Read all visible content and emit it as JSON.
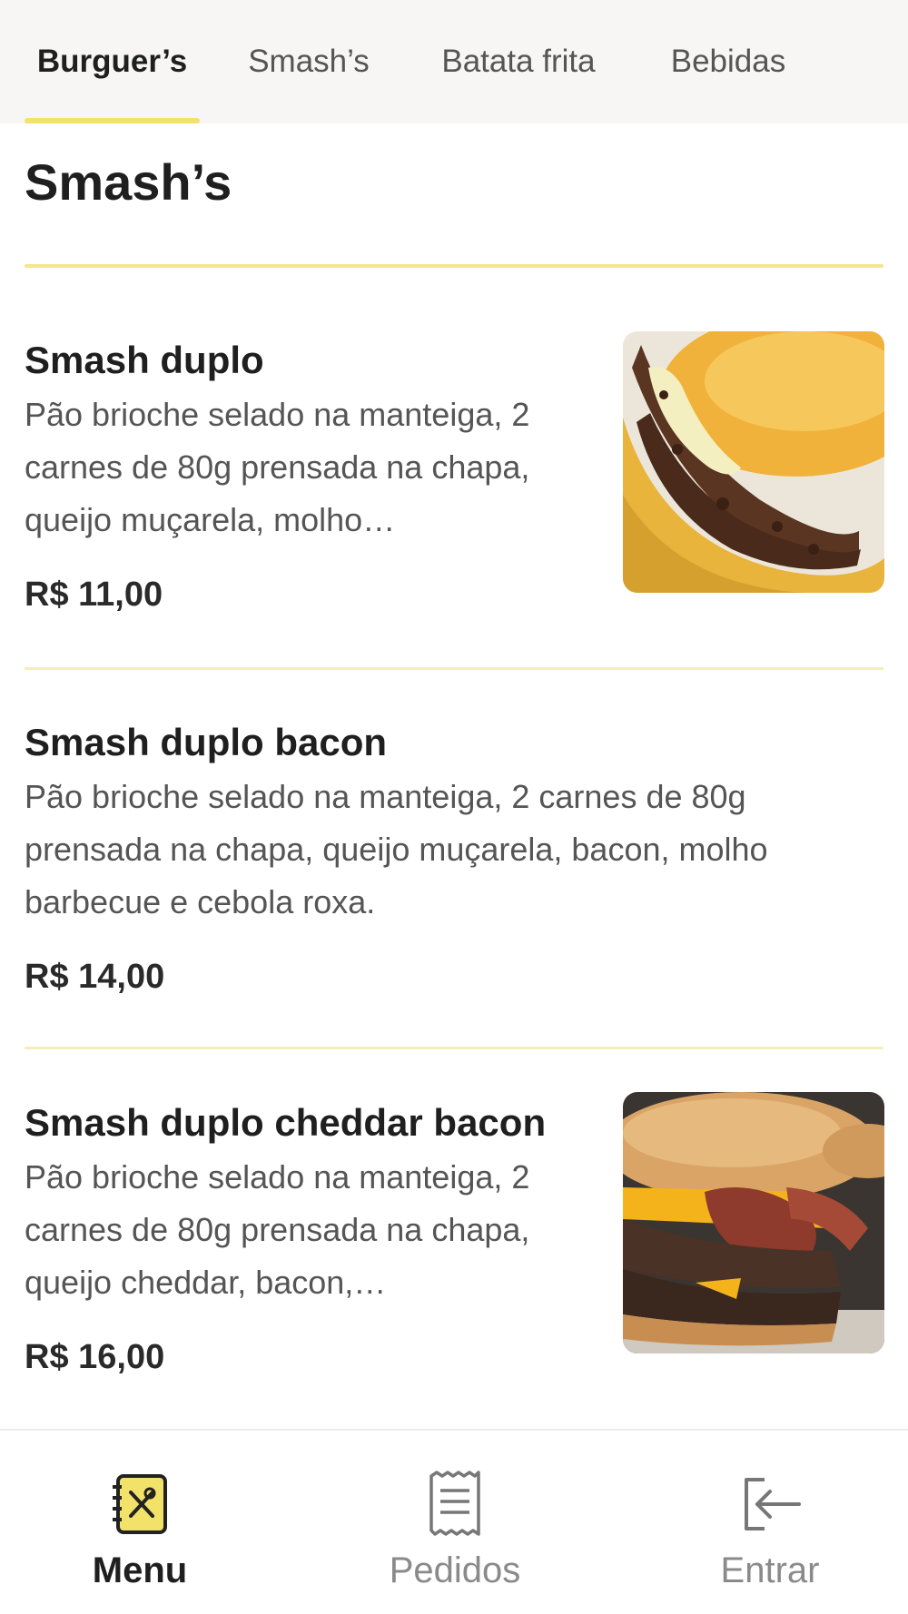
{
  "tabs": [
    {
      "label": "Burguer’s",
      "active": true
    },
    {
      "label": "Smash’s",
      "active": false
    },
    {
      "label": "Batata frita",
      "active": false
    },
    {
      "label": "Bebidas",
      "active": false
    }
  ],
  "section": {
    "title": "Smash’s"
  },
  "items": [
    {
      "name": "Smash duplo",
      "description": "Pão brioche selado na manteiga, 2 carnes de 80g prensada na chapa, queijo muçarela, molho…",
      "price": "R$ 11,00",
      "image": "smash-duplo-photo"
    },
    {
      "name": "Smash duplo bacon",
      "description": "Pão brioche selado na manteiga, 2 carnes de 80g prensada na chapa, queijo muçarela, bacon, molho barbecue e cebola roxa.",
      "price": "R$ 14,00"
    },
    {
      "name": "Smash duplo cheddar bacon",
      "description": "Pão brioche selado na manteiga, 2 carnes de 80g prensada na chapa, queijo cheddar, bacon,…",
      "price": "R$ 16,00",
      "image": "smash-duplo-cheddar-bacon-photo"
    }
  ],
  "bottom_nav": [
    {
      "label": "Menu",
      "icon": "menu-book-icon",
      "active": true
    },
    {
      "label": "Pedidos",
      "icon": "receipt-icon",
      "active": false
    },
    {
      "label": "Entrar",
      "icon": "login-icon",
      "active": false
    }
  ],
  "colors": {
    "accent": "#f3e26a",
    "divider": "#f6eeb8",
    "tab_bar_bg": "#f7f6f4",
    "text_dark": "#1f1f1f",
    "text_muted": "#555555"
  }
}
